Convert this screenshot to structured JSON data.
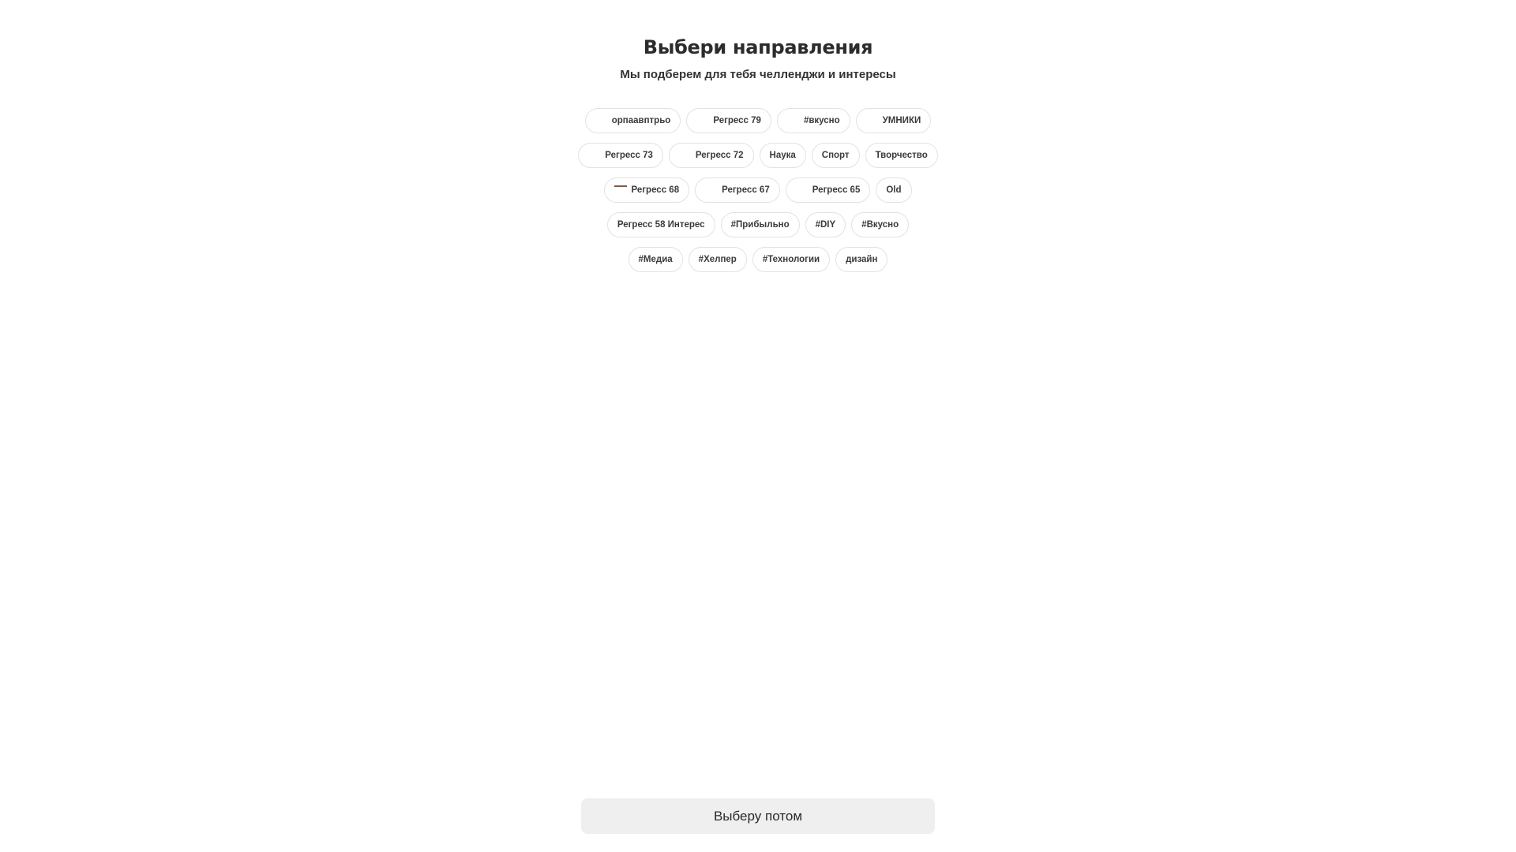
{
  "header": {
    "title": "Выбери направления",
    "subtitle": "Мы подберем для тебя челленджи и интересы"
  },
  "chips": {
    "rows": [
      [
        {
          "label": "орпаавптрьо",
          "icon": "blank-image-icon"
        },
        {
          "label": "Регресс 79",
          "icon": "blank-image-icon"
        },
        {
          "label": "#вкусно",
          "icon": "blank-image-icon"
        },
        {
          "label": "УМНИКИ",
          "icon": "blank-image-icon"
        }
      ],
      [
        {
          "label": "Регресс 73",
          "icon": "blank-image-icon"
        },
        {
          "label": "Регресс 72",
          "icon": "blank-image-icon"
        },
        {
          "label": "Наука"
        },
        {
          "label": "Спорт"
        },
        {
          "label": "Творчество"
        }
      ],
      [
        {
          "label": "Регресс 68",
          "icon": "thumbnail-image-icon"
        },
        {
          "label": "Регресс 67",
          "icon": "blank-image-icon"
        },
        {
          "label": "Регресс 65",
          "icon": "blank-image-icon"
        },
        {
          "label": "Old"
        }
      ],
      [
        {
          "label": "Регресс 58 Интерес"
        },
        {
          "label": "#Прибыльно"
        },
        {
          "label": "#DIY"
        },
        {
          "label": "#Вкусно"
        }
      ],
      [
        {
          "label": "#Медиа"
        },
        {
          "label": "#Хелпер"
        },
        {
          "label": "#Технологии"
        },
        {
          "label": "дизайн"
        }
      ]
    ]
  },
  "footer": {
    "later_label": "Выберу потом"
  },
  "colors": {
    "chip_border": "#e2e2e2",
    "button_background": "#efefef",
    "text": "#2b2b2b"
  }
}
